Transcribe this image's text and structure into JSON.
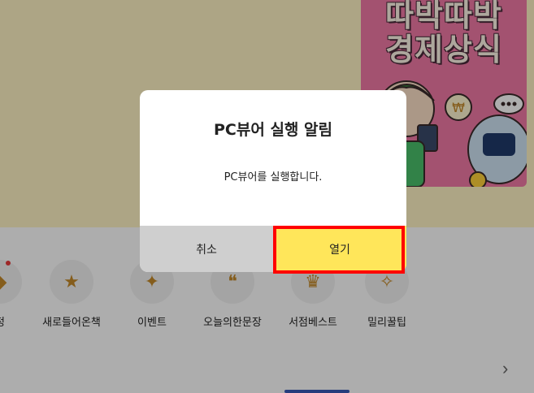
{
  "background": {
    "book": {
      "title_line1": "따박따박",
      "title_line2": "경제상식"
    },
    "categories": [
      {
        "label": "정",
        "icon": "badge-icon"
      },
      {
        "label": "새로들어온책",
        "icon": "new-badge-icon"
      },
      {
        "label": "이벤트",
        "icon": "party-popper-icon"
      },
      {
        "label": "오늘의한문장",
        "icon": "quote-card-icon"
      },
      {
        "label": "서점베스트",
        "icon": "crown-book-icon"
      },
      {
        "label": "밀리꿀팁",
        "icon": "lightbulb-icon"
      }
    ],
    "next_arrow": "›"
  },
  "modal": {
    "title": "PC뷰어 실행 알림",
    "message": "PC뷰어를 실행합니다.",
    "cancel_label": "취소",
    "open_label": "열기"
  },
  "colors": {
    "accent": "#ffe65a",
    "cancel_bg": "#cfcfcf",
    "highlight": "#ff0000",
    "hero_bg": "#fff3c4",
    "book_bg": "#f07aa6"
  }
}
